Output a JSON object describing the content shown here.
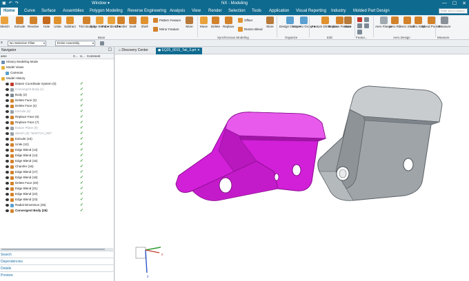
{
  "titlebar": {
    "title": "NX - Modeling",
    "window_label": "Window ▾",
    "controls": [
      "—",
      "☐",
      "✕"
    ]
  },
  "menubar": {
    "tabs": [
      "Home",
      "Curve",
      "Surface",
      "Assemblies",
      "Polygon Modeling",
      "Reverse Engineering",
      "Analysis",
      "View",
      "Render",
      "Selection",
      "Tools",
      "Application",
      "Visual Reporting",
      "Industry",
      "Molded Part Design"
    ],
    "active_tab": "Home",
    "search_placeholder": "Enter text to search"
  },
  "ribbon": {
    "buttons": [
      "Sketch",
      "Extrude",
      "Revolve",
      "Hole",
      "Unite",
      "Subtract",
      "Trim Body ▾",
      "Edge Blend ▾",
      "Face Blend ▾",
      "Chamfer",
      "Draft",
      "Shell",
      "More",
      "Move",
      "Delete",
      "Replace",
      "More",
      "Design Group ▾",
      "Move to Group ▾",
      "Feature Dimension",
      "Replace Feature",
      "More",
      "Aero Flange",
      "Aero Rib",
      "Aero Shelf",
      "Aero Step",
      "Blend Pocket",
      "Measure"
    ],
    "small_buttons": [
      "Pattern Feature",
      "Mirror Feature",
      "Offset",
      "Resize Blend"
    ],
    "groups": [
      "Base",
      "Synchronous Modeling",
      "Organize",
      "Edit",
      "Featur...",
      "Aero Design",
      "Measure"
    ]
  },
  "selbar": {
    "filter_label": "No Selection Filter",
    "scope_label": "Entire Assembly"
  },
  "navigator": {
    "title": "Navigator",
    "columns": [
      "ame",
      "C...",
      "U...",
      "Comment"
    ],
    "rows": [
      {
        "label": "History Modeling Mode",
        "indent": 0,
        "check": false,
        "dim": false,
        "eye": false,
        "icon": "#6b8db5"
      },
      {
        "label": "Model Views",
        "indent": 0,
        "check": false,
        "dim": false,
        "eye": false,
        "icon": "#e3b23c"
      },
      {
        "label": "Cameras",
        "indent": 1,
        "check": false,
        "dim": false,
        "eye": false,
        "icon": "#5aa0d0"
      },
      {
        "label": "Model History",
        "indent": 0,
        "check": false,
        "dim": false,
        "eye": false,
        "icon": "#e3b23c"
      },
      {
        "label": "Datum Coordinate System (0)",
        "indent": 1,
        "check": true,
        "dim": false,
        "eye": true,
        "icon": "#c0392b"
      },
      {
        "label": "Convergent Body (1)",
        "indent": 1,
        "check": true,
        "dim": true,
        "eye": true,
        "icon": "#9aa3ab"
      },
      {
        "label": "Body (2)",
        "indent": 1,
        "check": true,
        "dim": false,
        "eye": true,
        "icon": "#7d8a96"
      },
      {
        "label": "Delete Face (3)",
        "indent": 1,
        "check": true,
        "dim": false,
        "eye": true,
        "icon": "#d3822c"
      },
      {
        "label": "Delete Face (4)",
        "indent": 1,
        "check": true,
        "dim": false,
        "eye": true,
        "icon": "#d3822c"
      },
      {
        "label": "Extrude (5)",
        "indent": 1,
        "check": true,
        "dim": true,
        "eye": true,
        "icon": "#9aa3ab"
      },
      {
        "label": "Replace Face (6)",
        "indent": 1,
        "check": true,
        "dim": false,
        "eye": true,
        "icon": "#d3822c"
      },
      {
        "label": "Replace Face (7)",
        "indent": 1,
        "check": true,
        "dim": false,
        "eye": true,
        "icon": "#d3822c"
      },
      {
        "label": "Datum Plane (8)",
        "indent": 1,
        "check": true,
        "dim": true,
        "eye": true,
        "icon": "#9aa3ab"
      },
      {
        "label": "Sketch (9) \"SKETCH_000\"",
        "indent": 1,
        "check": true,
        "dim": true,
        "eye": true,
        "icon": "#9aa3ab"
      },
      {
        "label": "Extrude (10)",
        "indent": 1,
        "check": true,
        "dim": false,
        "eye": true,
        "icon": "#d3822c"
      },
      {
        "label": "Unite (12)",
        "indent": 1,
        "check": true,
        "dim": false,
        "eye": true,
        "icon": "#d3822c"
      },
      {
        "label": "Edge Blend (13)",
        "indent": 1,
        "check": true,
        "dim": false,
        "eye": true,
        "icon": "#d3822c"
      },
      {
        "label": "Edge Blend (14)",
        "indent": 1,
        "check": true,
        "dim": false,
        "eye": true,
        "icon": "#d3822c"
      },
      {
        "label": "Edge Blend (15)",
        "indent": 1,
        "check": true,
        "dim": false,
        "eye": true,
        "icon": "#d3822c"
      },
      {
        "label": "Chamfer (16)",
        "indent": 1,
        "check": true,
        "dim": false,
        "eye": true,
        "icon": "#d3822c"
      },
      {
        "label": "Edge Blend (17)",
        "indent": 1,
        "check": true,
        "dim": false,
        "eye": true,
        "icon": "#d3822c"
      },
      {
        "label": "Edge Blend (18)",
        "indent": 1,
        "check": true,
        "dim": false,
        "eye": true,
        "icon": "#d3822c"
      },
      {
        "label": "Delete Face (20)",
        "indent": 1,
        "check": true,
        "dim": false,
        "eye": true,
        "icon": "#d3822c"
      },
      {
        "label": "Edge Blend (21)",
        "indent": 1,
        "check": true,
        "dim": false,
        "eye": true,
        "icon": "#d3822c"
      },
      {
        "label": "Edge Blend (22)",
        "indent": 1,
        "check": true,
        "dim": false,
        "eye": true,
        "icon": "#d3822c"
      },
      {
        "label": "Edge Blend (23)",
        "indent": 1,
        "check": true,
        "dim": false,
        "eye": true,
        "icon": "#d3822c"
      },
      {
        "label": "Radial Dimension (25)",
        "indent": 1,
        "check": true,
        "dim": false,
        "eye": true,
        "icon": "#5aa0d0"
      },
      {
        "label": "Convergent Body (26)",
        "indent": 1,
        "check": true,
        "dim": false,
        "eye": true,
        "icon": "#d3822c",
        "bold": true
      }
    ],
    "panes": [
      "Search",
      "Dependencies",
      "Details",
      "Preview"
    ]
  },
  "doctabs": {
    "tabs": [
      "Discovery Center",
      "EQ25_0015_Tail_3.prt"
    ],
    "close": "✕"
  },
  "colors": {
    "accent": "#0f6a8f",
    "part_magenta": "#d21fd8",
    "part_gray": "#9ea4a8",
    "check_green": "#2e9a2e"
  }
}
